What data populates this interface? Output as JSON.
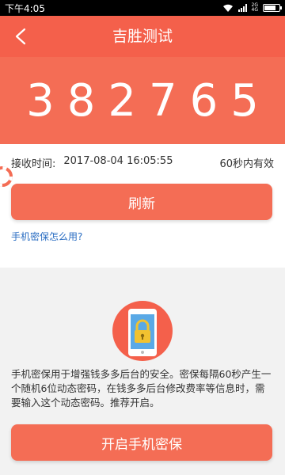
{
  "status_bar": {
    "time": "下午4:05",
    "network_top": "2G",
    "network_bottom": "4G",
    "battery_level": 0.8
  },
  "header": {
    "title": "吉胜测试",
    "back_icon": "chevron-left-icon"
  },
  "code": {
    "value": "382765"
  },
  "receive": {
    "label": "接收时间:",
    "time": "2017-08-04 16:05:55",
    "validity": "60秒内有效"
  },
  "buttons": {
    "refresh": "刷新",
    "enable": "开启手机密保"
  },
  "help_link": "手机密保怎么用?",
  "info": {
    "description": "手机密保用于增强钱多多后台的安全。密保每隔60秒产生一个随机6位动态密码，在钱多多后台修改费率等信息时，需要输入这个动态密码。推荐开启。",
    "illustration_icon": "phone-lock-icon"
  },
  "colors": {
    "header": "#f4604b",
    "accent": "#f46d55",
    "link": "#2a6dc2"
  }
}
